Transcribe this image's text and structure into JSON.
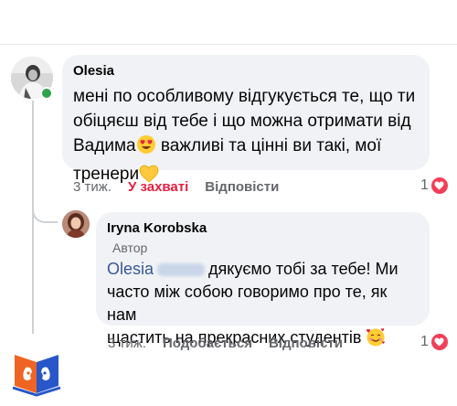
{
  "comment": {
    "author": "Olesia",
    "text_line1": "мені по особливому відгукується те, що ти",
    "text_line2": "обіцяєш від тебе і що можна отримати від",
    "text_line3a": "Вадима",
    "text_line3b": " важливі та цінні ви такі, мої",
    "text_line4": "тренери",
    "time": "3 тиж.",
    "like_label": "У захваті",
    "reply_label": "Відповісти",
    "reaction_count": "1",
    "emojis": [
      "heart-eyes-emoji",
      "yellow-heart-emoji"
    ]
  },
  "reply": {
    "author": "Iryna  Korobska",
    "badge": "Автор",
    "mention": "Olesia",
    "text_line1": "дякуємо тобі за тебе! Ми",
    "text_line2": "часто між собою говоримо про те, як нам",
    "text_line3": "щастить на прекрасних студентів",
    "time": "3 тиж.",
    "like_label": "Подобається",
    "reply_label": "Відповісти",
    "reaction_count": "1",
    "emojis": [
      "smiling-face-with-hearts-emoji"
    ]
  },
  "colors": {
    "bubble": "#f0f2f5",
    "mention": "#385898",
    "like_active": "#e41e3f",
    "heart": "#f33e58",
    "online": "#31a24c",
    "muted": "#65676b"
  },
  "logo": "open-book-faces-logo"
}
